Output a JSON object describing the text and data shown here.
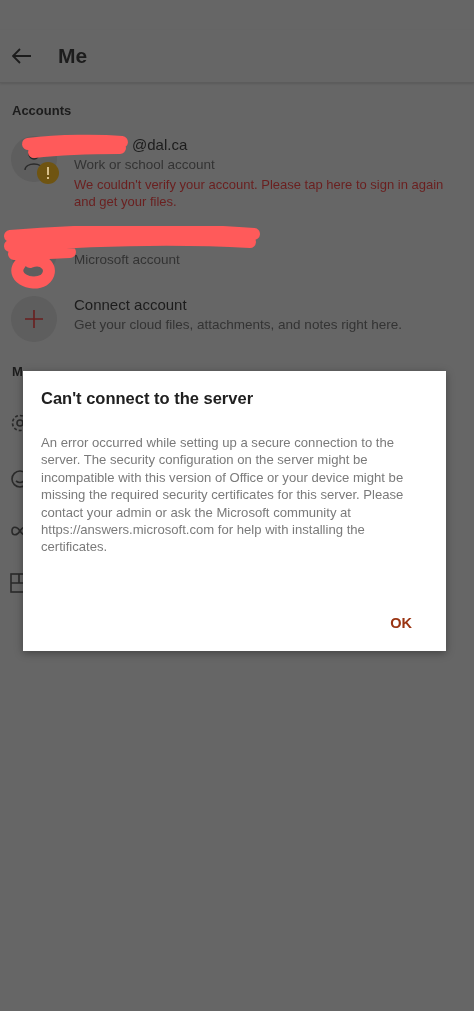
{
  "header": {
    "title": "Me"
  },
  "accounts_section": {
    "heading": "Accounts"
  },
  "accounts": [
    {
      "kind": "work",
      "name": "@dal.ca",
      "type": "Work or school account",
      "error": "We couldn't verify your account. Please tap here to sign in again and get your files.",
      "warning": true
    },
    {
      "kind": "personal",
      "type": "Microsoft account",
      "warning": false
    }
  ],
  "connect": {
    "title": "Connect account",
    "subtitle": "Get your cloud files, attachments, and notes right here."
  },
  "more_section": {
    "heading": "M"
  },
  "more_items": [
    {
      "kind": "gear"
    },
    {
      "kind": "smiley"
    },
    {
      "kind": "infinity"
    },
    {
      "kind": "layout"
    }
  ],
  "dialog": {
    "title": "Can't connect to the server",
    "message": "An error occurred while setting up a secure connection to the server. The security configuration on the server might be incompatible with this version of Office or your device might be missing the required security certificates for this server. Please contact your admin or ask the Microsoft community at https://answers.microsoft.com for help with installing the certificates.",
    "button": "OK"
  }
}
